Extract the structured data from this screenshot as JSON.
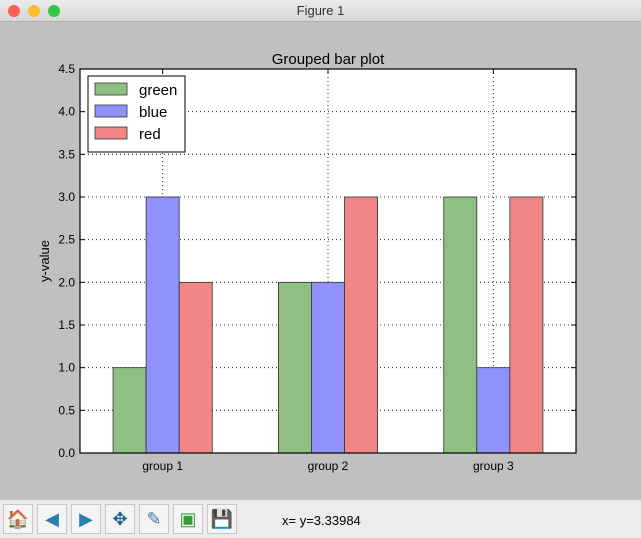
{
  "window": {
    "title": "Figure 1"
  },
  "toolbar": {
    "buttons": [
      {
        "icon": "home-icon",
        "glyph": "🏠"
      },
      {
        "icon": "back-arrow-icon",
        "glyph": "◀"
      },
      {
        "icon": "forward-arrow-icon",
        "glyph": "▶"
      },
      {
        "icon": "pan-move-icon",
        "glyph": "✥"
      },
      {
        "icon": "zoom-rect-icon",
        "glyph": "✎"
      },
      {
        "icon": "subplots-configure-icon",
        "glyph": "▣"
      },
      {
        "icon": "save-floppy-icon",
        "glyph": "💾"
      }
    ],
    "coord_readout": "x= y=3.33984"
  },
  "chart_data": {
    "type": "bar",
    "title": "Grouped bar plot",
    "xlabel": "",
    "ylabel": "y-value",
    "categories": [
      "group 1",
      "group 2",
      "group 3"
    ],
    "series": [
      {
        "name": "green",
        "values": [
          1,
          2,
          3
        ],
        "color": "#8fbf83"
      },
      {
        "name": "blue",
        "values": [
          3,
          2,
          1
        ],
        "color": "#9191fc"
      },
      {
        "name": "red",
        "values": [
          2,
          3,
          3
        ],
        "color": "#f08686"
      }
    ],
    "ylim": [
      0,
      4.5
    ],
    "yticks": [
      "0.0",
      "0.5",
      "1.0",
      "1.5",
      "2.0",
      "2.5",
      "3.0",
      "3.5",
      "4.0",
      "4.5"
    ],
    "grid": true,
    "legend_position": "top-left"
  }
}
